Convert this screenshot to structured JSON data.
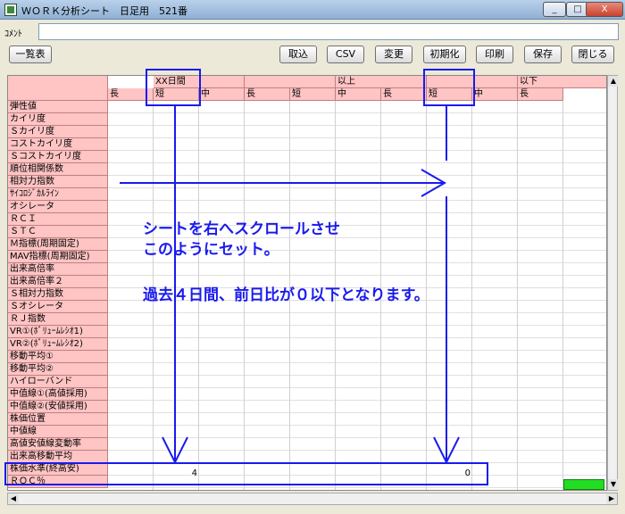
{
  "window": {
    "title": "ＷＯＲＫ分析シート　日足用　521番",
    "buttons": {
      "minimize": "_",
      "maximize": "□",
      "close": "X"
    }
  },
  "comment": {
    "label": "ｺﾒﾝﾄ",
    "value": ""
  },
  "toolbar": {
    "list_label": "一覧表",
    "import_label": "取込",
    "csv_label": "CSV",
    "change_label": "変更",
    "init_label": "初期化",
    "print_label": "印刷",
    "save_label": "保存",
    "close_label": "閉じる"
  },
  "grid": {
    "group_headers": [
      "XX日間",
      "",
      "以上",
      "",
      "以下",
      ""
    ],
    "sub_headers": [
      "長",
      "短",
      "中",
      "長",
      "短",
      "中",
      "長",
      "短",
      "中",
      "長"
    ],
    "rows": [
      "弾性値",
      "カイリ度",
      "Ｓカイリ度",
      "コストカイリ度",
      "Ｓコストカイリ度",
      "順位相関係数",
      "相対力指数",
      "ｻｲｺﾛｼﾞｶﾙﾗｲﾝ",
      "オシレータ",
      "ＲＣＩ",
      "ＳＴＣ",
      "Ｍ指標(周期固定)",
      "MAV指標(周期固定)",
      "出来高倍率",
      "出来高倍率２",
      "Ｓ相対力指数",
      "Ｓオシレータ",
      "ＲＪ指数",
      "VR①(ﾎﾞﾘｭｰﾑﾚｼｵ1)",
      "VR②(ﾎﾞﾘｭｰﾑﾚｼｵ2)",
      "移動平均①",
      "移動平均②",
      "ハイローバンド",
      "中值線①(高値採用)",
      "中值線②(安値採用)",
      "株価位置",
      "中値線",
      "高値安値線変動率",
      "出来高移動平均",
      "株価水準(終高安)",
      "ＲＯＣ％"
    ],
    "roc_values": {
      "short_xx": "4",
      "short_below": "0"
    }
  },
  "annotation": {
    "line1": "シートを右へスクロールさせ",
    "line2": "このようにセット。",
    "line3": "過去４日間、前日比が０以下となります。"
  },
  "colors": {
    "header_bg": "#ffc4c4",
    "annotation": "#1a1aee",
    "status_green": "#22dd22"
  }
}
